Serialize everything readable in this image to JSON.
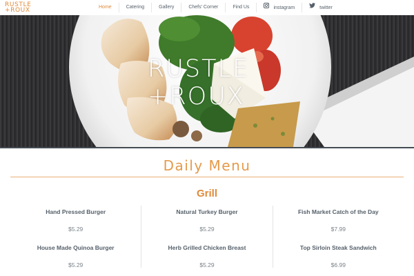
{
  "brand": {
    "logo_line1": "RUSTLE",
    "logo_line2": "+ROUX",
    "hero_line1": "RUSTLE",
    "hero_line2": "+ROUX"
  },
  "nav": {
    "items": [
      {
        "label": "Home",
        "active": true
      },
      {
        "label": "Catering"
      },
      {
        "label": "Gallery"
      },
      {
        "label": "Chefs' Corner"
      },
      {
        "label": "Find Us"
      },
      {
        "label": "instagram",
        "icon": "instagram-icon"
      },
      {
        "label": "twitter",
        "icon": "twitter-icon"
      }
    ]
  },
  "colors": {
    "accent": "#e08a3a",
    "text": "#55606a",
    "divider": "#e9b07a"
  },
  "menu": {
    "title": "Daily Menu",
    "section": "Grill",
    "columns": [
      [
        {
          "name": "Hand Pressed Burger",
          "price": "$5.29"
        },
        {
          "name": "House Made Quinoa Burger",
          "price": "$5.29"
        }
      ],
      [
        {
          "name": "Natural Turkey Burger",
          "price": "$5.29"
        },
        {
          "name": "Herb Grilled Chicken Breast",
          "price": "$5.29"
        }
      ],
      [
        {
          "name": "Fish Market Catch of the Day",
          "price": "$7.99"
        },
        {
          "name": "Top Sirloin Steak Sandwich",
          "price": "$6.99"
        }
      ]
    ]
  }
}
